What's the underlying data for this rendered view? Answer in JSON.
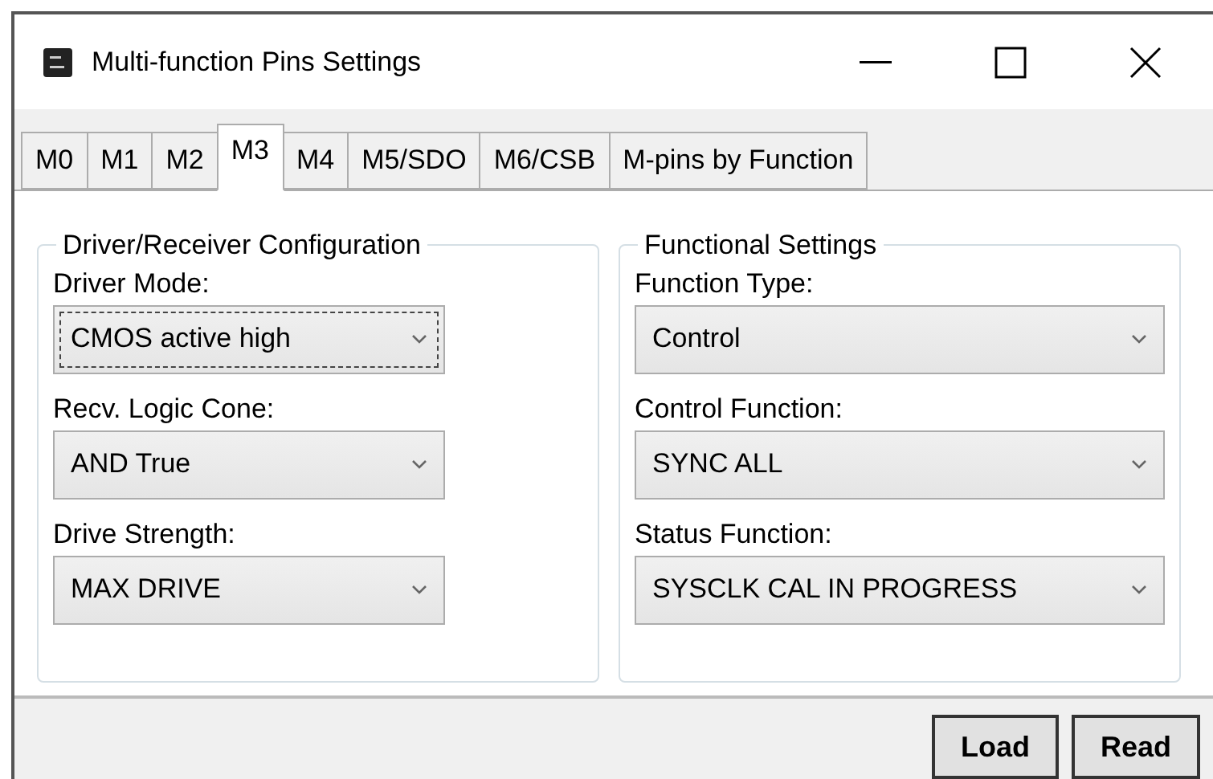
{
  "window": {
    "title": "Multi-function Pins Settings"
  },
  "tabs": [
    {
      "label": "M0",
      "selected": false
    },
    {
      "label": "M1",
      "selected": false
    },
    {
      "label": "M2",
      "selected": false
    },
    {
      "label": "M3",
      "selected": true
    },
    {
      "label": "M4",
      "selected": false
    },
    {
      "label": "M5/SDO",
      "selected": false
    },
    {
      "label": "M6/CSB",
      "selected": false
    },
    {
      "label": "M-pins by Function",
      "selected": false
    }
  ],
  "groups": [
    {
      "title": "Driver/Receiver Configuration",
      "fields": [
        {
          "label": "Driver Mode:",
          "value": "CMOS active high",
          "focused": true
        },
        {
          "label": "Recv. Logic Cone:",
          "value": "AND True",
          "focused": false
        },
        {
          "label": "Drive Strength:",
          "value": "MAX DRIVE",
          "focused": false
        }
      ]
    },
    {
      "title": "Functional Settings",
      "fields": [
        {
          "label": "Function Type:",
          "value": "Control",
          "focused": false
        },
        {
          "label": "Control Function:",
          "value": "SYNC ALL",
          "focused": false
        },
        {
          "label": "Status Function:",
          "value": "SYSCLK CAL IN PROGRESS",
          "focused": false
        }
      ]
    }
  ],
  "buttons": [
    "Load",
    "Read"
  ]
}
